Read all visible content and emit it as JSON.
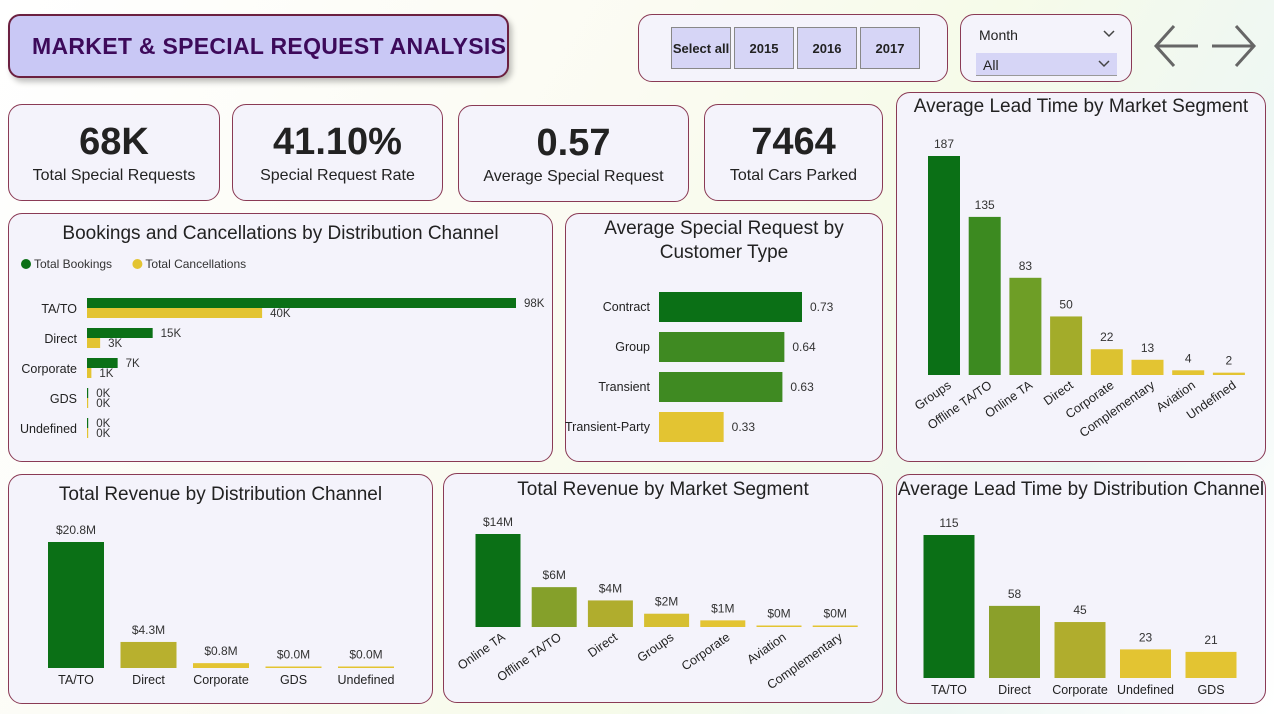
{
  "title": "MARKET & SPECIAL REQUEST ANALYSIS",
  "year_slicer": {
    "items": [
      "Select all",
      "2015",
      "2016",
      "2017"
    ]
  },
  "month_slicer": {
    "label": "Month",
    "value": "All"
  },
  "nav": {
    "back_icon": "arrow-left-icon",
    "forward_icon": "arrow-right-icon"
  },
  "kpis": [
    {
      "value": "68K",
      "label": "Total Special Requests"
    },
    {
      "value": "41.10%",
      "label": "Special Request Rate"
    },
    {
      "value": "0.57",
      "label": "Average Special Request"
    },
    {
      "value": "7464",
      "label": "Total Cars Parked"
    }
  ],
  "colors": {
    "dark_green": "#0b7016",
    "yellow": "#e3c432",
    "border": "#8a3a55",
    "title_bg": "#c9c8f5"
  },
  "chart_data": [
    {
      "id": "bookings_cancellations",
      "type": "bar",
      "orientation": "horizontal",
      "title": "Bookings and Cancellations by Distribution Channel",
      "categories": [
        "TA/TO",
        "Direct",
        "Corporate",
        "GDS",
        "Undefined"
      ],
      "series": [
        {
          "name": "Total Bookings",
          "values": [
            98,
            15,
            7,
            0,
            0
          ],
          "labels": [
            "98K",
            "15K",
            "7K",
            "0K",
            "0K"
          ],
          "color": "#0b7016"
        },
        {
          "name": "Total Cancellations",
          "values": [
            40,
            3,
            1,
            0,
            0
          ],
          "labels": [
            "40K",
            "3K",
            "1K",
            "0K",
            "0K"
          ],
          "color": "#e3c432"
        }
      ],
      "legend": "top-left"
    },
    {
      "id": "avg_special_request_customer",
      "type": "bar",
      "orientation": "horizontal",
      "title": "Average Special Request by Customer Type",
      "categories": [
        "Contract",
        "Group",
        "Transient",
        "Transient-Party"
      ],
      "values": [
        0.73,
        0.64,
        0.63,
        0.33
      ],
      "labels": [
        "0.73",
        "0.64",
        "0.63",
        "0.33"
      ],
      "colors": [
        "#0b7016",
        "#3f8a22",
        "#3f8a22",
        "#e3c432"
      ]
    },
    {
      "id": "avg_lead_time_market",
      "type": "bar",
      "title": "Average Lead Time by Market Segment",
      "categories": [
        "Groups",
        "Offline TA/TO",
        "Online TA",
        "Direct",
        "Corporate",
        "Complementary",
        "Aviation",
        "Undefined"
      ],
      "values": [
        187,
        135,
        83,
        50,
        22,
        13,
        4,
        2
      ],
      "labels": [
        "187",
        "135",
        "83",
        "50",
        "22",
        "13",
        "4",
        "2"
      ],
      "colors": [
        "#0b7016",
        "#3c8a20",
        "#6e9e26",
        "#a3ac2a",
        "#dcc230",
        "#e3c432",
        "#e3c432",
        "#e3c432"
      ]
    },
    {
      "id": "revenue_channel",
      "type": "bar",
      "title": "Total Revenue by Distribution Channel",
      "categories": [
        "TA/TO",
        "Direct",
        "Corporate",
        "GDS",
        "Undefined"
      ],
      "values": [
        20.8,
        4.3,
        0.8,
        0.0,
        0.0
      ],
      "labels": [
        "$20.8M",
        "$4.3M",
        "$0.8M",
        "$0.0M",
        "$0.0M"
      ],
      "colors": [
        "#0b7016",
        "#b8b02e",
        "#e3c432",
        "#e3c432",
        "#e3c432"
      ]
    },
    {
      "id": "revenue_market",
      "type": "bar",
      "title": "Total Revenue by Market Segment",
      "categories": [
        "Online TA",
        "Offline TA/TO",
        "Direct",
        "Groups",
        "Corporate",
        "Aviation",
        "Complementary"
      ],
      "values": [
        14,
        6,
        4,
        2,
        1,
        0,
        0
      ],
      "labels": [
        "$14M",
        "$6M",
        "$4M",
        "$2M",
        "$1M",
        "$0M",
        "$0M"
      ],
      "colors": [
        "#0b7016",
        "#85a02a",
        "#b0ad2d",
        "#d6bf31",
        "#e3c432",
        "#e3c432",
        "#e3c432"
      ]
    },
    {
      "id": "avg_lead_time_channel",
      "type": "bar",
      "title": "Average Lead Time by Distribution Channel",
      "categories": [
        "TA/TO",
        "Direct",
        "Corporate",
        "Undefined",
        "GDS"
      ],
      "values": [
        115,
        58,
        45,
        23,
        21
      ],
      "labels": [
        "115",
        "58",
        "45",
        "23",
        "21"
      ],
      "colors": [
        "#0b7016",
        "#8ba02a",
        "#b0ad2d",
        "#e3c432",
        "#e3c432"
      ]
    }
  ]
}
